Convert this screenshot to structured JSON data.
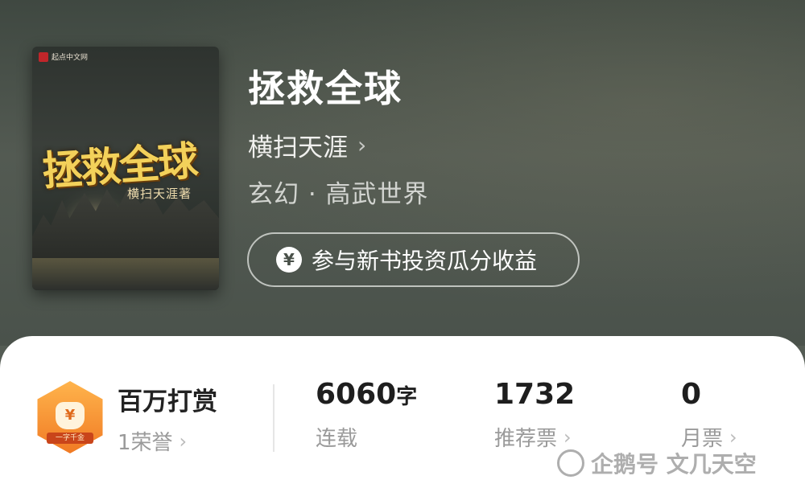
{
  "book": {
    "cover": {
      "publisher": "起点中文网",
      "title": "拯救全球",
      "author": "横扫天涯著"
    },
    "title": "拯救全球",
    "author": "横扫天涯",
    "genre": "玄幻 · 高武世界",
    "invest_button": "参与新书投资瓜分收益",
    "icons": {
      "author_chevron": "chevron-right-icon",
      "yen": "yen-icon"
    }
  },
  "stats": {
    "tip": {
      "title": "百万打赏",
      "subtitle": "1荣誉",
      "badge_text": "一字千金",
      "badge_icon": "money-bag-icon"
    },
    "words": {
      "value": "6060",
      "unit": "字",
      "label": "连载"
    },
    "recommend": {
      "value": "1732",
      "label": "推荐票"
    },
    "monthly": {
      "value": "0",
      "label": "月票"
    }
  },
  "watermark": {
    "text": "企鹅号 文几天空"
  },
  "colors": {
    "hero_bg": "#4e564f",
    "card_bg": "#ffffff",
    "badge_orange": "#f07a24",
    "cover_gold": "#f3d15a"
  }
}
